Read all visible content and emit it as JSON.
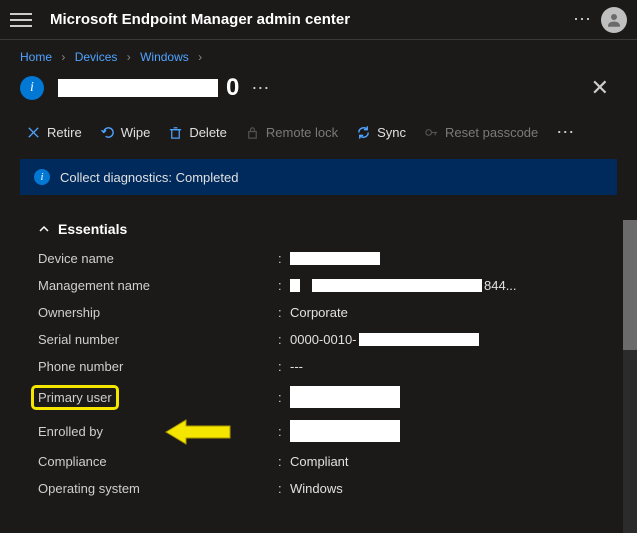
{
  "header": {
    "app_title": "Microsoft Endpoint Manager admin center"
  },
  "breadcrumbs": {
    "items": [
      "Home",
      "Devices",
      "Windows"
    ]
  },
  "device_heading": {
    "title_suffix": "0"
  },
  "toolbar": {
    "retire": "Retire",
    "wipe": "Wipe",
    "delete": "Delete",
    "remote_lock": "Remote lock",
    "sync": "Sync",
    "reset_passcode": "Reset passcode"
  },
  "banner": {
    "message": "Collect diagnostics: Completed"
  },
  "essentials": {
    "heading": "Essentials",
    "rows": {
      "device_name": {
        "label": "Device name",
        "value": ""
      },
      "management_name": {
        "label": "Management name",
        "prefix": "",
        "suffix": "844..."
      },
      "ownership": {
        "label": "Ownership",
        "value": "Corporate"
      },
      "serial_number": {
        "label": "Serial number",
        "prefix": "0000-0010-",
        "suffix": ""
      },
      "phone_number": {
        "label": "Phone number",
        "value": "---"
      },
      "primary_user": {
        "label": "Primary user",
        "value": ""
      },
      "enrolled_by": {
        "label": "Enrolled by",
        "value": ""
      },
      "compliance": {
        "label": "Compliance",
        "value": "Compliant"
      },
      "operating_system": {
        "label": "Operating system",
        "value": "Windows"
      }
    }
  }
}
